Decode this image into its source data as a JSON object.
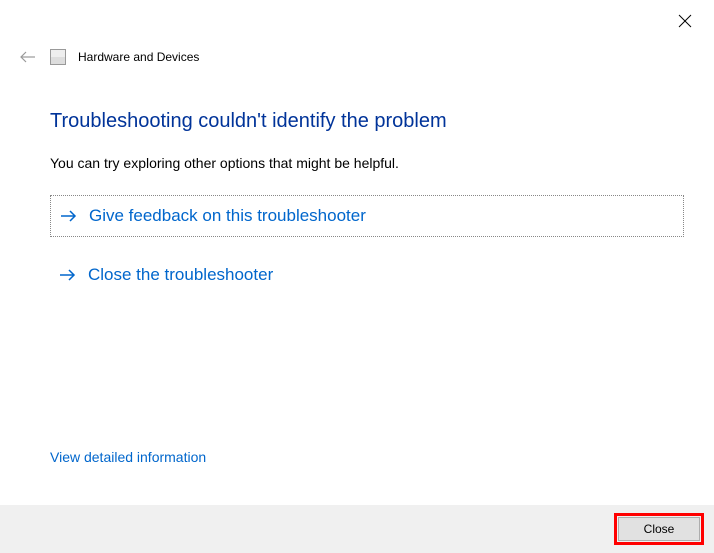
{
  "window": {
    "close_icon_name": "close-icon"
  },
  "header": {
    "title": "Hardware and Devices"
  },
  "main": {
    "heading": "Troubleshooting couldn't identify the problem",
    "subtext": "You can try exploring other options that might be helpful.",
    "options": [
      {
        "label": "Give feedback on this troubleshooter"
      },
      {
        "label": "Close the troubleshooter"
      }
    ],
    "view_details": "View detailed information"
  },
  "footer": {
    "close_button": "Close"
  },
  "annotation": {
    "highlight_target": "close-button"
  }
}
